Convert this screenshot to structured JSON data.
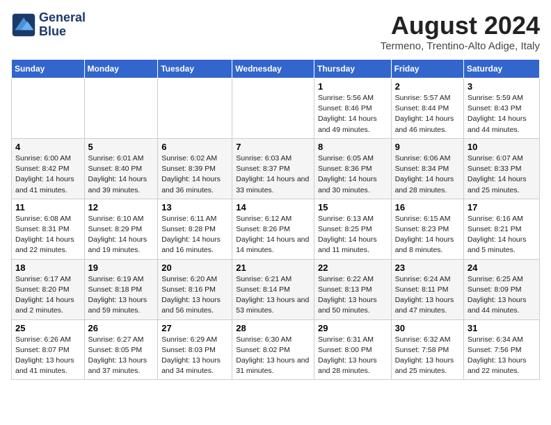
{
  "header": {
    "logo_line1": "General",
    "logo_line2": "Blue",
    "title": "August 2024",
    "subtitle": "Termeno, Trentino-Alto Adige, Italy"
  },
  "days_of_week": [
    "Sunday",
    "Monday",
    "Tuesday",
    "Wednesday",
    "Thursday",
    "Friday",
    "Saturday"
  ],
  "weeks": [
    [
      {
        "day": "",
        "detail": ""
      },
      {
        "day": "",
        "detail": ""
      },
      {
        "day": "",
        "detail": ""
      },
      {
        "day": "",
        "detail": ""
      },
      {
        "day": "1",
        "detail": "Sunrise: 5:56 AM\nSunset: 8:46 PM\nDaylight: 14 hours and 49 minutes."
      },
      {
        "day": "2",
        "detail": "Sunrise: 5:57 AM\nSunset: 8:44 PM\nDaylight: 14 hours and 46 minutes."
      },
      {
        "day": "3",
        "detail": "Sunrise: 5:59 AM\nSunset: 8:43 PM\nDaylight: 14 hours and 44 minutes."
      }
    ],
    [
      {
        "day": "4",
        "detail": "Sunrise: 6:00 AM\nSunset: 8:42 PM\nDaylight: 14 hours and 41 minutes."
      },
      {
        "day": "5",
        "detail": "Sunrise: 6:01 AM\nSunset: 8:40 PM\nDaylight: 14 hours and 39 minutes."
      },
      {
        "day": "6",
        "detail": "Sunrise: 6:02 AM\nSunset: 8:39 PM\nDaylight: 14 hours and 36 minutes."
      },
      {
        "day": "7",
        "detail": "Sunrise: 6:03 AM\nSunset: 8:37 PM\nDaylight: 14 hours and 33 minutes."
      },
      {
        "day": "8",
        "detail": "Sunrise: 6:05 AM\nSunset: 8:36 PM\nDaylight: 14 hours and 30 minutes."
      },
      {
        "day": "9",
        "detail": "Sunrise: 6:06 AM\nSunset: 8:34 PM\nDaylight: 14 hours and 28 minutes."
      },
      {
        "day": "10",
        "detail": "Sunrise: 6:07 AM\nSunset: 8:33 PM\nDaylight: 14 hours and 25 minutes."
      }
    ],
    [
      {
        "day": "11",
        "detail": "Sunrise: 6:08 AM\nSunset: 8:31 PM\nDaylight: 14 hours and 22 minutes."
      },
      {
        "day": "12",
        "detail": "Sunrise: 6:10 AM\nSunset: 8:29 PM\nDaylight: 14 hours and 19 minutes."
      },
      {
        "day": "13",
        "detail": "Sunrise: 6:11 AM\nSunset: 8:28 PM\nDaylight: 14 hours and 16 minutes."
      },
      {
        "day": "14",
        "detail": "Sunrise: 6:12 AM\nSunset: 8:26 PM\nDaylight: 14 hours and 14 minutes."
      },
      {
        "day": "15",
        "detail": "Sunrise: 6:13 AM\nSunset: 8:25 PM\nDaylight: 14 hours and 11 minutes."
      },
      {
        "day": "16",
        "detail": "Sunrise: 6:15 AM\nSunset: 8:23 PM\nDaylight: 14 hours and 8 minutes."
      },
      {
        "day": "17",
        "detail": "Sunrise: 6:16 AM\nSunset: 8:21 PM\nDaylight: 14 hours and 5 minutes."
      }
    ],
    [
      {
        "day": "18",
        "detail": "Sunrise: 6:17 AM\nSunset: 8:20 PM\nDaylight: 14 hours and 2 minutes."
      },
      {
        "day": "19",
        "detail": "Sunrise: 6:19 AM\nSunset: 8:18 PM\nDaylight: 13 hours and 59 minutes."
      },
      {
        "day": "20",
        "detail": "Sunrise: 6:20 AM\nSunset: 8:16 PM\nDaylight: 13 hours and 56 minutes."
      },
      {
        "day": "21",
        "detail": "Sunrise: 6:21 AM\nSunset: 8:14 PM\nDaylight: 13 hours and 53 minutes."
      },
      {
        "day": "22",
        "detail": "Sunrise: 6:22 AM\nSunset: 8:13 PM\nDaylight: 13 hours and 50 minutes."
      },
      {
        "day": "23",
        "detail": "Sunrise: 6:24 AM\nSunset: 8:11 PM\nDaylight: 13 hours and 47 minutes."
      },
      {
        "day": "24",
        "detail": "Sunrise: 6:25 AM\nSunset: 8:09 PM\nDaylight: 13 hours and 44 minutes."
      }
    ],
    [
      {
        "day": "25",
        "detail": "Sunrise: 6:26 AM\nSunset: 8:07 PM\nDaylight: 13 hours and 41 minutes."
      },
      {
        "day": "26",
        "detail": "Sunrise: 6:27 AM\nSunset: 8:05 PM\nDaylight: 13 hours and 37 minutes."
      },
      {
        "day": "27",
        "detail": "Sunrise: 6:29 AM\nSunset: 8:03 PM\nDaylight: 13 hours and 34 minutes."
      },
      {
        "day": "28",
        "detail": "Sunrise: 6:30 AM\nSunset: 8:02 PM\nDaylight: 13 hours and 31 minutes."
      },
      {
        "day": "29",
        "detail": "Sunrise: 6:31 AM\nSunset: 8:00 PM\nDaylight: 13 hours and 28 minutes."
      },
      {
        "day": "30",
        "detail": "Sunrise: 6:32 AM\nSunset: 7:58 PM\nDaylight: 13 hours and 25 minutes."
      },
      {
        "day": "31",
        "detail": "Sunrise: 6:34 AM\nSunset: 7:56 PM\nDaylight: 13 hours and 22 minutes."
      }
    ]
  ]
}
